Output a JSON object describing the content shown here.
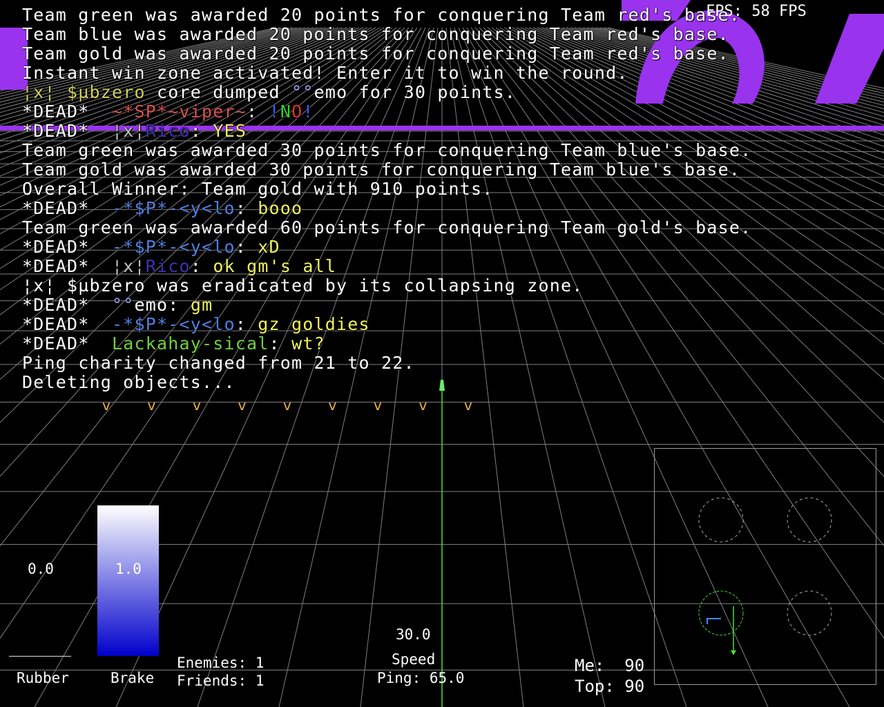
{
  "fps": "FPS: 58 FPS",
  "console_lines": [
    [
      {
        "t": "Team green was awarded 20 points for conquering Team red's base.",
        "c": "#ffffff"
      }
    ],
    [
      {
        "t": "Team blue was awarded 20 points for conquering Team red's base.",
        "c": "#ffffff"
      }
    ],
    [
      {
        "t": "Team gold was awarded 20 points for conquering Team red's base.",
        "c": "#ffffff"
      }
    ],
    [
      {
        "t": "Instant win zone activated! Enter it to win the round.",
        "c": "#ffffff"
      }
    ],
    [
      {
        "t": "¦x¦ $µbzero",
        "c": "#d0d060"
      },
      {
        "t": " core dumped ",
        "c": "#ffffff"
      },
      {
        "t": "°°",
        "c": "#9aa9ff"
      },
      {
        "t": "emo for 30 points.",
        "c": "#ffffff"
      }
    ],
    [
      {
        "t": "*DEAD*  ",
        "c": "#ffffff"
      },
      {
        "t": "~*SP*~viper~",
        "c": "#e05050"
      },
      {
        "t": ": ",
        "c": "#ffffff"
      },
      {
        "t": "!",
        "c": "#3060ff"
      },
      {
        "t": "N",
        "c": "#30d030"
      },
      {
        "t": "O",
        "c": "#e03030"
      },
      {
        "t": "!",
        "c": "#3060ff"
      }
    ],
    [
      {
        "t": "*DEAD*  ",
        "c": "#ffffff"
      },
      {
        "t": "¦x¦",
        "c": "#c0c0c0"
      },
      {
        "t": "Rico",
        "c": "#4030b0"
      },
      {
        "t": ": ",
        "c": "#ffffff"
      },
      {
        "t": "YES",
        "c": "#f0f060"
      }
    ],
    [
      {
        "t": "Team green was awarded 30 points for conquering Team blue's base.",
        "c": "#ffffff"
      }
    ],
    [
      {
        "t": "Team gold was awarded 30 points for conquering Team blue's base.",
        "c": "#ffffff"
      }
    ],
    [
      {
        "t": "Overall Winner: Team gold with 910 points.",
        "c": "#ffffff"
      }
    ],
    [
      {
        "t": "*DEAD*  ",
        "c": "#ffffff"
      },
      {
        "t": "-*$P*-<y<lo",
        "c": "#4f7fe0"
      },
      {
        "t": ": ",
        "c": "#ffffff"
      },
      {
        "t": "booo",
        "c": "#f0f060"
      }
    ],
    [
      {
        "t": "Team green was awarded 60 points for conquering Team gold's base.",
        "c": "#ffffff"
      }
    ],
    [
      {
        "t": "*DEAD*  ",
        "c": "#ffffff"
      },
      {
        "t": "-*$P*-<y<lo",
        "c": "#4f7fe0"
      },
      {
        "t": ": ",
        "c": "#ffffff"
      },
      {
        "t": "xD",
        "c": "#f0f060"
      }
    ],
    [
      {
        "t": "*DEAD*  ",
        "c": "#ffffff"
      },
      {
        "t": "¦x¦",
        "c": "#c0c0c0"
      },
      {
        "t": "Rico",
        "c": "#4030b0"
      },
      {
        "t": ": ",
        "c": "#ffffff"
      },
      {
        "t": "ok gm's all",
        "c": "#f0f060"
      }
    ],
    [
      {
        "t": "¦x¦ $µbzero was eradicated by its collapsing zone.",
        "c": "#ffffff"
      }
    ],
    [
      {
        "t": "*DEAD*  ",
        "c": "#ffffff"
      },
      {
        "t": "°°",
        "c": "#9aa9ff"
      },
      {
        "t": "emo",
        "c": "#ffffff"
      },
      {
        "t": ": ",
        "c": "#ffffff"
      },
      {
        "t": "gm",
        "c": "#f0f060"
      }
    ],
    [
      {
        "t": "*DEAD*  ",
        "c": "#ffffff"
      },
      {
        "t": "-*$P*-<y<lo",
        "c": "#4f7fe0"
      },
      {
        "t": ": ",
        "c": "#ffffff"
      },
      {
        "t": "gz goldies",
        "c": "#f0f060"
      }
    ],
    [
      {
        "t": "*DEAD*  ",
        "c": "#ffffff"
      },
      {
        "t": "Lackahay-sical",
        "c": "#70d040"
      },
      {
        "t": ": ",
        "c": "#ffffff"
      },
      {
        "t": "wt?",
        "c": "#f0f060"
      }
    ],
    [
      {
        "t": "Ping charity changed from 21 to 22.",
        "c": "#ffffff"
      }
    ],
    [
      {
        "t": "Deleting objects...",
        "c": "#ffffff"
      }
    ]
  ],
  "hud": {
    "rubber_value": "0.0",
    "rubber_label": "Rubber",
    "brake_value": "1.0",
    "brake_label": "Brake",
    "brake_level": 1.0,
    "rubber_level": 0.0,
    "enemies": "Enemies: 1",
    "friends": "Friends: 1",
    "speed_value": "30.0",
    "speed_label": "Speed",
    "ping": "Ping: 65.0",
    "me_score": "Me:  90",
    "top_score": "Top: 90"
  },
  "markers": [
    "v",
    "v",
    "v",
    "v",
    "v",
    "v",
    "v",
    "v",
    "v"
  ],
  "colors": {
    "grid": "#7f7f7f",
    "banner": "#9933ee",
    "player_trail": "#44dd44",
    "minimap_player": "#4488ff"
  }
}
